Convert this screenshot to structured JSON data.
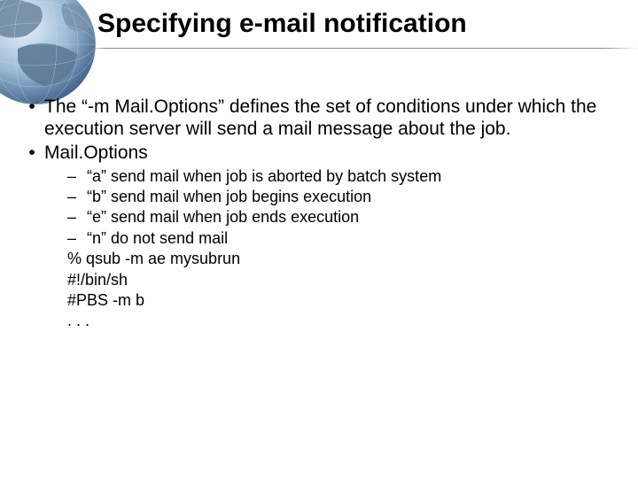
{
  "title": "Specifying e-mail notification",
  "bullets": {
    "b1": "The “-m Mail.Options” defines the set of conditions under which the execution server will send a mail message about the job.",
    "b2": "Mail.Options",
    "sub_a": "“a” send mail when job is aborted by batch system",
    "sub_b": "“b” send mail when job begins execution",
    "sub_e": "“e” send mail when job ends execution",
    "sub_n": "“n” do not send mail",
    "line1": "% qsub -m ae mysubrun",
    "line2": "#!/bin/sh",
    "line3": "#PBS -m b",
    "line4": ". . ."
  }
}
